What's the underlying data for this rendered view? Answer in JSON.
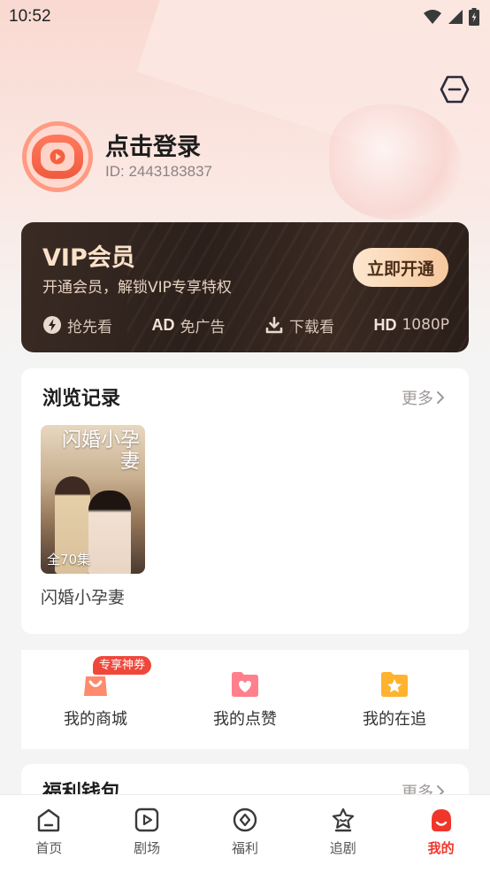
{
  "status_bar": {
    "time": "10:52"
  },
  "profile": {
    "login_label": "点击登录",
    "user_id": "ID: 2443183837"
  },
  "vip": {
    "title": "VIP会员",
    "subtitle": "开通会员，解锁VIP专享特权",
    "button_label": "立即开通",
    "perks": [
      {
        "icon": "lightning-icon",
        "label": "抢先看"
      },
      {
        "icon": "ad-icon",
        "tag": "AD",
        "label": "免广告"
      },
      {
        "icon": "download-icon",
        "label": "下载看"
      },
      {
        "icon": "hd-icon",
        "tag": "HD",
        "label": "1080P"
      }
    ]
  },
  "history": {
    "title": "浏览记录",
    "more_label": "更多",
    "items": [
      {
        "poster_title": "闪婚小孕妻",
        "episode_count": "全70集",
        "name": "闪婚小孕妻"
      }
    ]
  },
  "actions": {
    "badge": "专享神券",
    "items": [
      {
        "icon": "shopping-bag-icon",
        "label": "我的商城"
      },
      {
        "icon": "heart-folder-icon",
        "label": "我的点赞"
      },
      {
        "icon": "star-folder-icon",
        "label": "我的在追"
      }
    ]
  },
  "wallet": {
    "title": "福利钱包",
    "more_label": "更多"
  },
  "bottom_nav": {
    "items": [
      {
        "icon": "home-icon",
        "label": "首页",
        "active": false
      },
      {
        "icon": "play-square-icon",
        "label": "剧场",
        "active": false
      },
      {
        "icon": "gift-diamond-icon",
        "label": "福利",
        "active": false
      },
      {
        "icon": "star-home-icon",
        "label": "追剧",
        "active": false
      },
      {
        "icon": "profile-icon",
        "label": "我的",
        "active": true
      }
    ]
  },
  "colors": {
    "accent": "#f0362b",
    "vip_gold": "#fbe1c8",
    "vip_bg": "#2c201b",
    "top_gradient": "#f9d9d1"
  }
}
